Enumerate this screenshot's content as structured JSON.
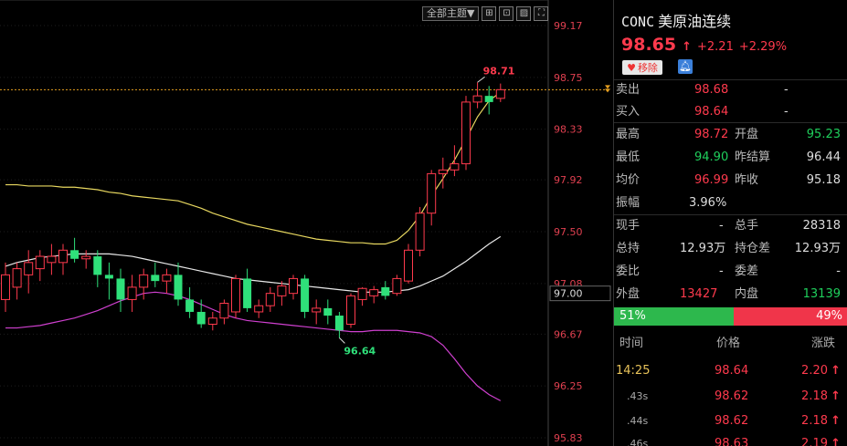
{
  "header": {
    "code": "CONC",
    "name": "美原油连续",
    "price": "98.65",
    "arrow": "↑",
    "change": "+2.21",
    "change_pct": "+2.29%",
    "remove_label": "移除"
  },
  "toolbar": {
    "theme_label": "全部主题▼",
    "icons": [
      "grid-icon",
      "reset-icon",
      "picture-icon",
      "fullscreen-icon"
    ]
  },
  "quote": {
    "sell_label": "卖出",
    "sell_price": "98.68",
    "sell_vol": "-",
    "buy_label": "买入",
    "buy_price": "98.64",
    "buy_vol": "-",
    "high_label": "最高",
    "high": "98.72",
    "open_label": "开盘",
    "open": "95.23",
    "low_label": "最低",
    "low": "94.90",
    "prev_settle_label": "昨结算",
    "prev_settle": "96.44",
    "avg_label": "均价",
    "avg": "96.99",
    "prev_close_label": "昨收",
    "prev_close": "95.18",
    "amp_label": "振幅",
    "amp": "3.96%",
    "cur_label": "现手",
    "cur": "-",
    "total_label": "总手",
    "total": "28318",
    "hold_label": "总持",
    "hold": "12.93万",
    "hold_diff_label": "持仓差",
    "hold_diff": "12.93万",
    "ratio_label": "委比",
    "ratio": "-",
    "diff_label": "委差",
    "diff": "-",
    "outer_label": "外盘",
    "outer": "13427",
    "inner_label": "内盘",
    "inner": "13139",
    "outer_pct": "51%",
    "inner_pct": "49%",
    "outer_fraction": 0.51
  },
  "ticks": {
    "headers": [
      "时间",
      "价格",
      "涨跌"
    ],
    "rows": [
      {
        "time": "14:25",
        "price": "98.64",
        "chg": "2.20",
        "arrow": "↑"
      },
      {
        "time": ".43s",
        "price": "98.62",
        "chg": "2.18",
        "arrow": "↑"
      },
      {
        "time": ".44s",
        "price": "98.62",
        "chg": "2.18",
        "arrow": "↑"
      },
      {
        "time": ".46s",
        "price": "98.63",
        "chg": "2.19",
        "arrow": "↑"
      }
    ]
  },
  "chart_data": {
    "type": "candlestick",
    "y_ticks": [
      "99.17",
      "98.75",
      "98.33",
      "97.92",
      "97.50",
      "97.08",
      "97.00",
      "96.67",
      "96.25",
      "95.83"
    ],
    "ylim": [
      95.83,
      99.17
    ],
    "high_label": "98.71",
    "low_label": "96.64",
    "current_price": 98.65,
    "candles": [
      {
        "o": 96.95,
        "h": 97.25,
        "l": 96.85,
        "c": 97.15
      },
      {
        "o": 97.05,
        "h": 97.25,
        "l": 96.95,
        "c": 97.2
      },
      {
        "o": 97.15,
        "h": 97.35,
        "l": 97.0,
        "c": 97.25
      },
      {
        "o": 97.2,
        "h": 97.35,
        "l": 97.1,
        "c": 97.3
      },
      {
        "o": 97.25,
        "h": 97.4,
        "l": 97.15,
        "c": 97.3
      },
      {
        "o": 97.25,
        "h": 97.4,
        "l": 97.15,
        "c": 97.35
      },
      {
        "o": 97.35,
        "h": 97.45,
        "l": 97.25,
        "c": 97.28
      },
      {
        "o": 97.28,
        "h": 97.35,
        "l": 97.2,
        "c": 97.3
      },
      {
        "o": 97.3,
        "h": 97.35,
        "l": 97.05,
        "c": 97.15
      },
      {
        "o": 97.15,
        "h": 97.25,
        "l": 96.95,
        "c": 97.12
      },
      {
        "o": 97.12,
        "h": 97.2,
        "l": 96.85,
        "c": 96.95
      },
      {
        "o": 96.95,
        "h": 97.15,
        "l": 96.85,
        "c": 97.05
      },
      {
        "o": 97.05,
        "h": 97.2,
        "l": 96.95,
        "c": 97.15
      },
      {
        "o": 97.15,
        "h": 97.25,
        "l": 97.05,
        "c": 97.1
      },
      {
        "o": 97.1,
        "h": 97.2,
        "l": 97.0,
        "c": 97.15
      },
      {
        "o": 97.15,
        "h": 97.25,
        "l": 96.9,
        "c": 96.95
      },
      {
        "o": 96.95,
        "h": 97.05,
        "l": 96.8,
        "c": 96.85
      },
      {
        "o": 96.85,
        "h": 96.95,
        "l": 96.72,
        "c": 96.75
      },
      {
        "o": 96.75,
        "h": 96.85,
        "l": 96.7,
        "c": 96.8
      },
      {
        "o": 96.8,
        "h": 96.95,
        "l": 96.75,
        "c": 96.92
      },
      {
        "o": 96.85,
        "h": 97.15,
        "l": 96.8,
        "c": 97.12
      },
      {
        "o": 97.12,
        "h": 97.2,
        "l": 96.85,
        "c": 96.88
      },
      {
        "o": 96.85,
        "h": 96.95,
        "l": 96.8,
        "c": 96.9
      },
      {
        "o": 96.9,
        "h": 97.05,
        "l": 96.85,
        "c": 97.0
      },
      {
        "o": 96.98,
        "h": 97.1,
        "l": 96.9,
        "c": 97.06
      },
      {
        "o": 97.0,
        "h": 97.15,
        "l": 96.95,
        "c": 97.12
      },
      {
        "o": 97.12,
        "h": 97.15,
        "l": 96.8,
        "c": 96.85
      },
      {
        "o": 96.85,
        "h": 96.95,
        "l": 96.75,
        "c": 96.88
      },
      {
        "o": 96.88,
        "h": 96.95,
        "l": 96.75,
        "c": 96.82
      },
      {
        "o": 96.82,
        "h": 96.85,
        "l": 96.64,
        "c": 96.7
      },
      {
        "o": 96.75,
        "h": 97.0,
        "l": 96.72,
        "c": 96.98
      },
      {
        "o": 96.95,
        "h": 97.05,
        "l": 96.9,
        "c": 97.04
      },
      {
        "o": 96.98,
        "h": 97.06,
        "l": 96.92,
        "c": 97.03
      },
      {
        "o": 97.05,
        "h": 97.1,
        "l": 96.95,
        "c": 96.98
      },
      {
        "o": 97.0,
        "h": 97.15,
        "l": 96.98,
        "c": 97.12
      },
      {
        "o": 97.1,
        "h": 97.4,
        "l": 97.08,
        "c": 97.35
      },
      {
        "o": 97.35,
        "h": 97.7,
        "l": 97.3,
        "c": 97.65
      },
      {
        "o": 97.65,
        "h": 98.0,
        "l": 97.55,
        "c": 97.97
      },
      {
        "o": 97.97,
        "h": 98.1,
        "l": 97.85,
        "c": 98.0
      },
      {
        "o": 98.0,
        "h": 98.2,
        "l": 97.95,
        "c": 98.05
      },
      {
        "o": 98.05,
        "h": 98.6,
        "l": 98.0,
        "c": 98.55
      },
      {
        "o": 98.55,
        "h": 98.71,
        "l": 98.5,
        "c": 98.6
      },
      {
        "o": 98.6,
        "h": 98.68,
        "l": 98.45,
        "c": 98.55
      },
      {
        "o": 98.58,
        "h": 98.7,
        "l": 98.55,
        "c": 98.65
      }
    ],
    "ma_yellow": [
      97.88,
      97.88,
      97.87,
      97.87,
      97.87,
      97.86,
      97.86,
      97.85,
      97.84,
      97.82,
      97.81,
      97.79,
      97.78,
      97.77,
      97.76,
      97.75,
      97.72,
      97.69,
      97.65,
      97.62,
      97.59,
      97.56,
      97.54,
      97.52,
      97.5,
      97.48,
      97.46,
      97.44,
      97.43,
      97.42,
      97.41,
      97.41,
      97.4,
      97.4,
      97.43,
      97.51,
      97.63,
      97.79,
      97.93,
      98.08,
      98.25,
      98.43,
      98.56,
      98.63
    ],
    "ma_white": [
      97.22,
      97.25,
      97.27,
      97.29,
      97.3,
      97.31,
      97.32,
      97.32,
      97.32,
      97.32,
      97.31,
      97.3,
      97.28,
      97.26,
      97.24,
      97.22,
      97.2,
      97.18,
      97.16,
      97.14,
      97.12,
      97.11,
      97.1,
      97.09,
      97.08,
      97.07,
      97.06,
      97.05,
      97.04,
      97.03,
      97.02,
      97.01,
      97.01,
      97.01,
      97.02,
      97.03,
      97.06,
      97.1,
      97.14,
      97.2,
      97.26,
      97.33,
      97.4,
      97.46
    ],
    "ma_magenta": [
      96.72,
      96.72,
      96.73,
      96.74,
      96.76,
      96.78,
      96.8,
      96.83,
      96.86,
      96.9,
      96.94,
      96.97,
      97.0,
      97.01,
      97.0,
      96.98,
      96.95,
      96.91,
      96.87,
      96.83,
      96.8,
      96.78,
      96.77,
      96.76,
      96.75,
      96.74,
      96.73,
      96.72,
      96.71,
      96.7,
      96.69,
      96.69,
      96.7,
      96.7,
      96.7,
      96.69,
      96.68,
      96.65,
      96.58,
      96.47,
      96.35,
      96.25,
      96.18,
      96.13
    ]
  }
}
